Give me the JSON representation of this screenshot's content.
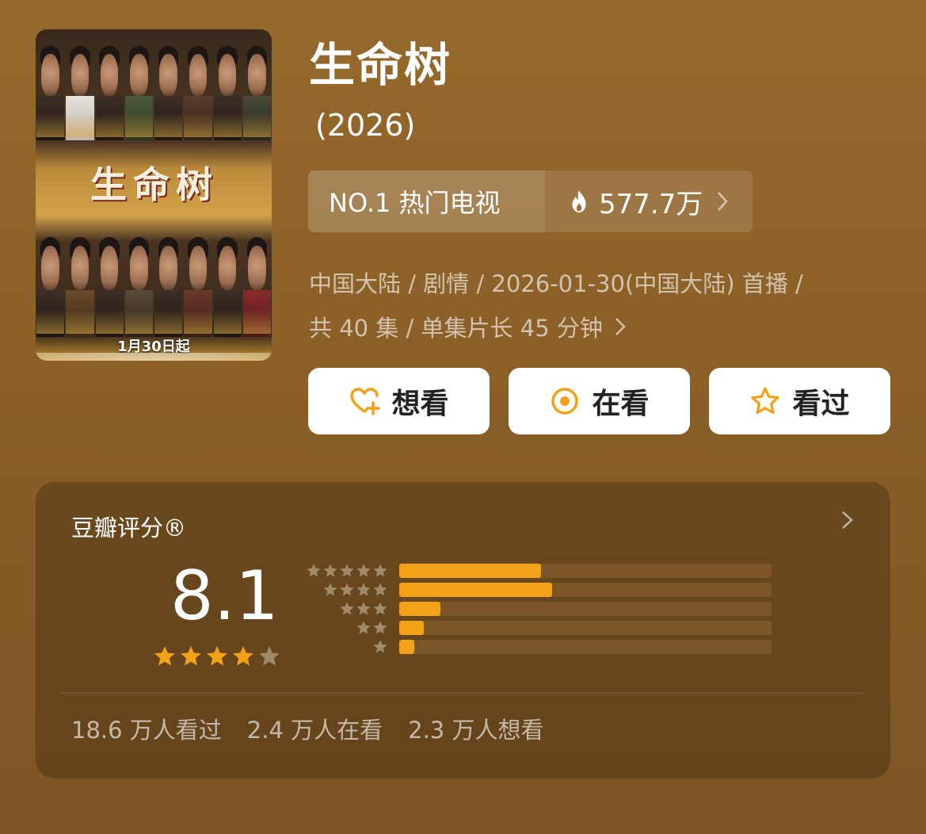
{
  "poster": {
    "title_art": "生命树",
    "release_text": "1月30日起"
  },
  "header": {
    "title": "生命树",
    "year": "(2026)"
  },
  "rank": {
    "label": "NO.1 热门电视",
    "heat_icon": "flame-icon",
    "heat_value": "577.7万"
  },
  "meta": {
    "line1": "中国大陆 / 剧情 / 2026-01-30(中国大陆) 首播 /",
    "line2": "共 40 集 / 单集片长 45 分钟"
  },
  "actions": [
    {
      "label": "想看",
      "icon": "heart-plus-icon"
    },
    {
      "label": "在看",
      "icon": "target-circle-icon"
    },
    {
      "label": "看过",
      "icon": "star-outline-icon"
    }
  ],
  "rating": {
    "label": "豆瓣评分®",
    "score": "8.1",
    "star_level": 4,
    "star_max": 5,
    "distribution": [
      {
        "stars": 5,
        "fraction": 0.38
      },
      {
        "stars": 4,
        "fraction": 0.41
      },
      {
        "stars": 3,
        "fraction": 0.11
      },
      {
        "stars": 2,
        "fraction": 0.065
      },
      {
        "stars": 1,
        "fraction": 0.04
      }
    ]
  },
  "stats": {
    "watched": "18.6 万人看过",
    "watching": "2.4 万人在看",
    "want": "2.3 万人想看"
  },
  "colors": {
    "accent": "#f2a218",
    "background": "#8f632b",
    "star_empty": "#a08a6a"
  }
}
